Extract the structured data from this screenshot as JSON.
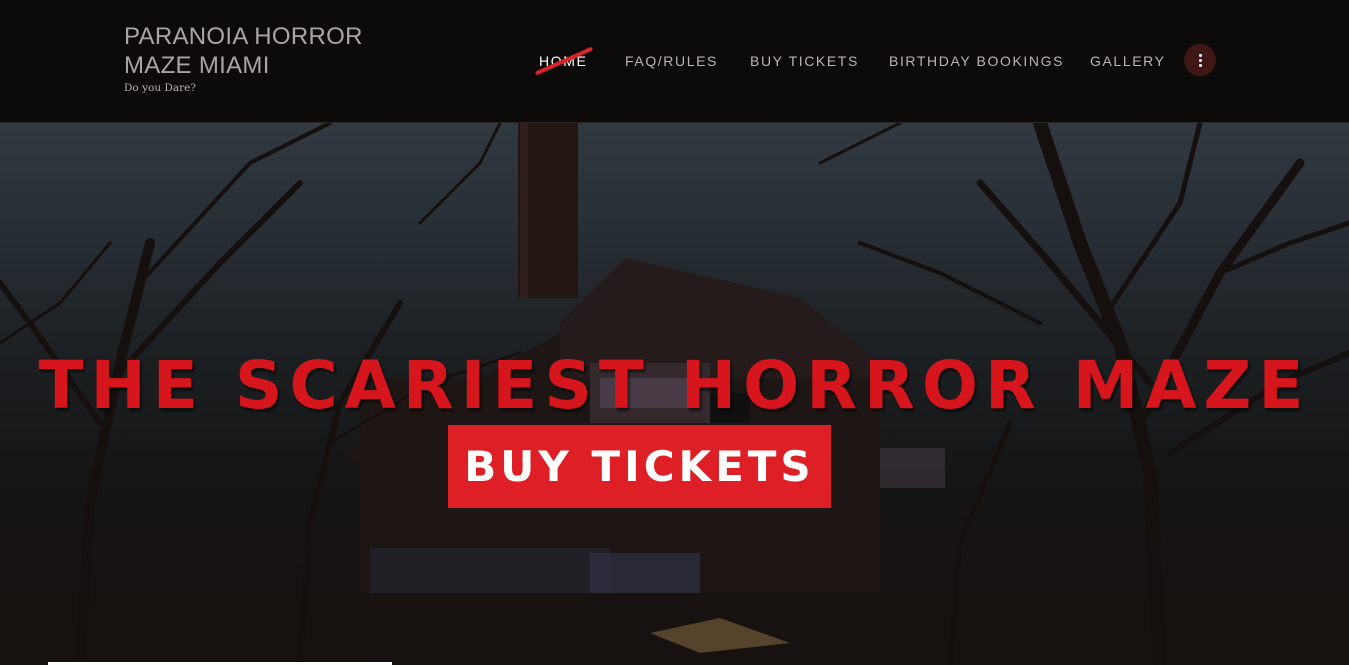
{
  "brand": {
    "title_line1": "PARANOIA HORROR",
    "title_line2": "MAZE MIAMI",
    "tagline": "Do you Dare?"
  },
  "nav": {
    "items": [
      {
        "label": "HOME",
        "active": true
      },
      {
        "label": "FAQ/RULES",
        "active": false
      },
      {
        "label": "BUY TICKETS",
        "active": false
      },
      {
        "label": "BIRTHDAY BOOKINGS",
        "active": false
      },
      {
        "label": "GALLERY",
        "active": false
      }
    ],
    "more_icon": "vertical-ellipsis-icon"
  },
  "hero": {
    "heading": "THE SCARIEST HORROR MAZE",
    "cta_label": "BUY TICKETS"
  },
  "colors": {
    "accent": "#de1f25",
    "heading_red": "#d6151c",
    "header_bg": "#0d0b0a",
    "more_button_bg": "#3f1717"
  }
}
